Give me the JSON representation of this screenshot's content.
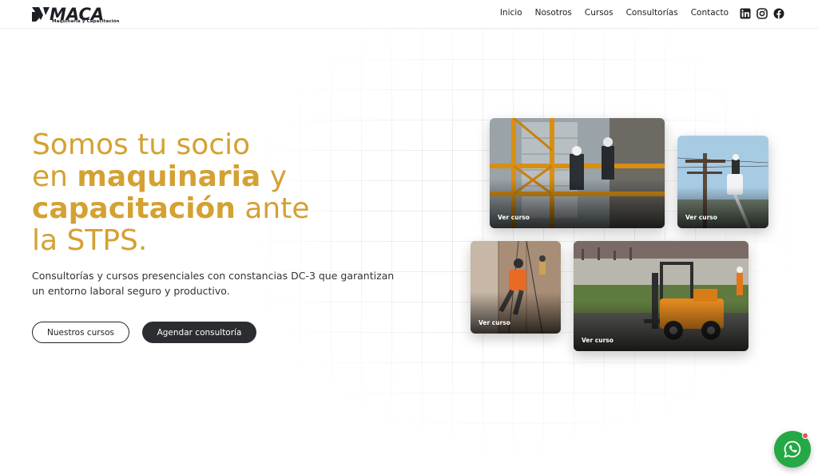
{
  "brand": {
    "name": "MACA",
    "tagline": "Maquinaria y Capacitación",
    "accent_color": "#d4a132",
    "dark_color": "#2b2d31"
  },
  "nav": {
    "items": [
      {
        "label": "Inicio"
      },
      {
        "label": "Nosotros"
      },
      {
        "label": "Cursos"
      },
      {
        "label": "Consultorías"
      },
      {
        "label": "Contacto"
      }
    ]
  },
  "social": {
    "icons": [
      "linkedin-icon",
      "instagram-icon",
      "facebook-icon"
    ]
  },
  "hero": {
    "title_line1": "Somos tu socio",
    "title_line2_pre": "en ",
    "title_line2_bold": "maquinaria",
    "title_line2_post": " y",
    "title_line3_bold": "capacitación",
    "title_line3_post": " ante",
    "title_line4": "la STPS.",
    "description": "Consultorías y cursos presenciales con constancias DC-3 que garantizan un entorno laboral seguro y productivo.",
    "btn_courses": "Nuestros cursos",
    "btn_consult": "Agendar consultoría"
  },
  "cards": [
    {
      "label": "Ver curso"
    },
    {
      "label": "Ver curso"
    },
    {
      "label": "Ver curso"
    },
    {
      "label": "Ver curso"
    }
  ],
  "whatsapp": {
    "icon": "whatsapp-icon",
    "color": "#25a845"
  }
}
